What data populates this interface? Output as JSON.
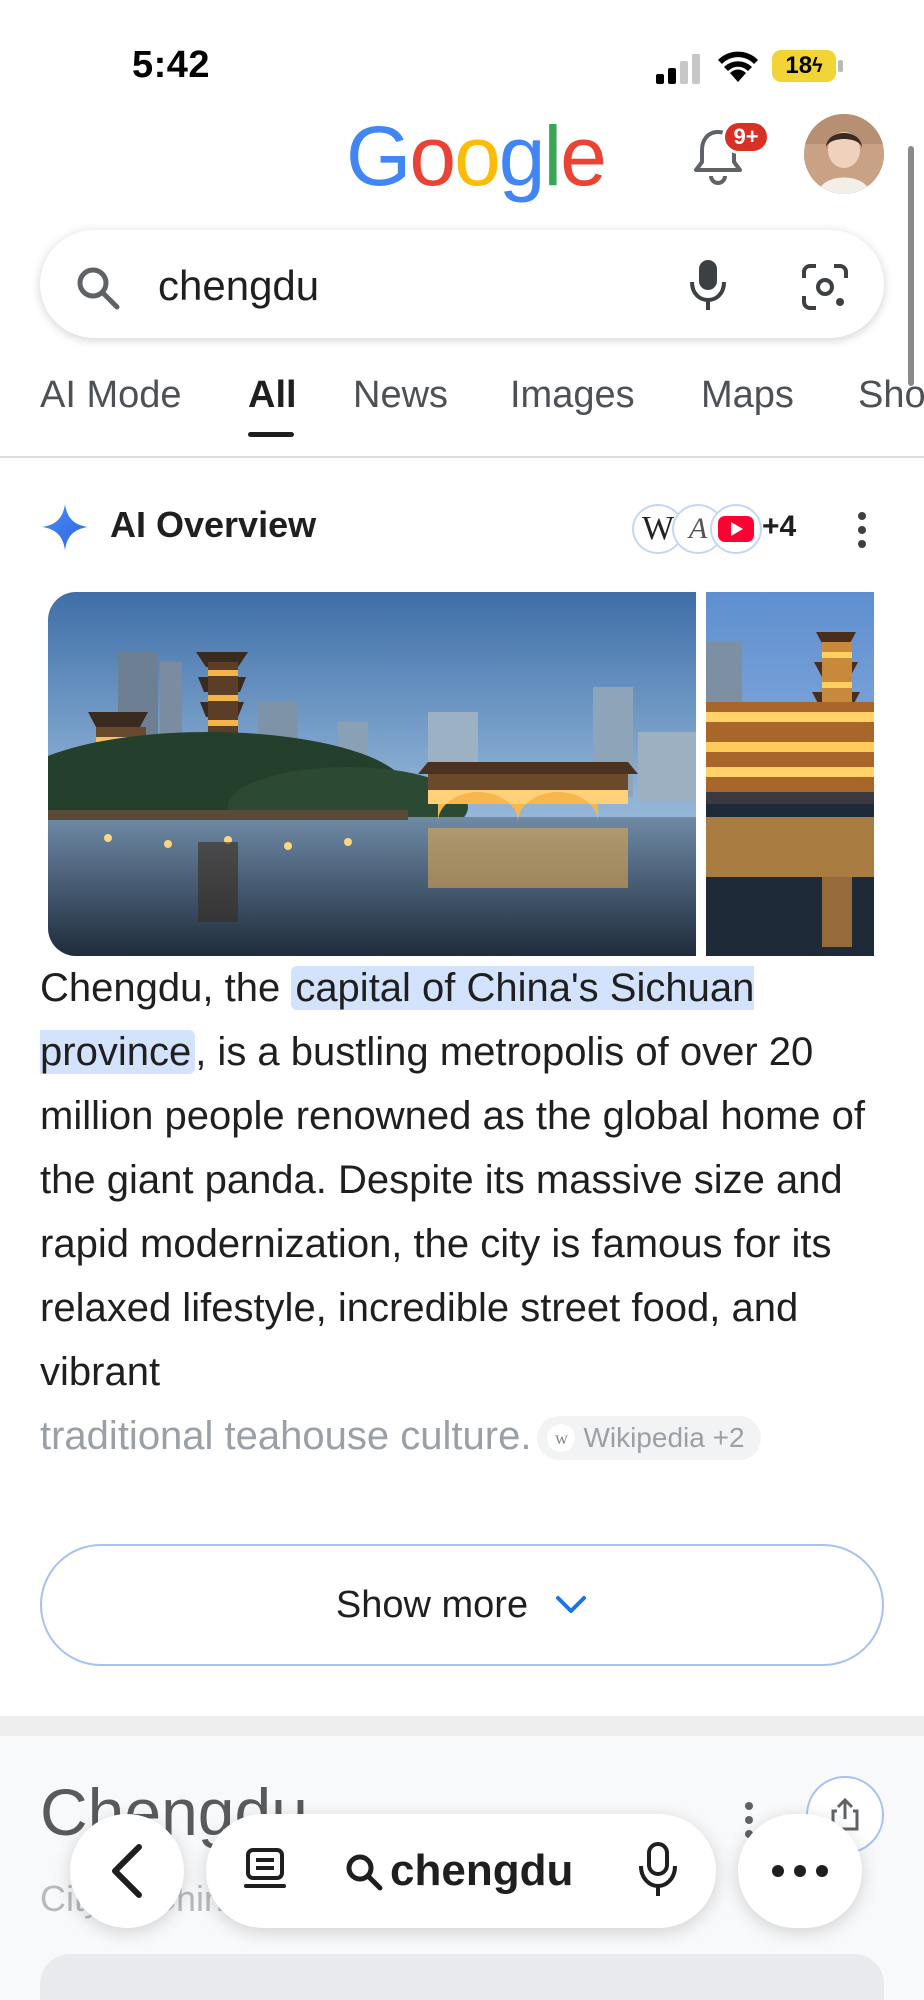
{
  "status_bar": {
    "time": "5:42",
    "battery": "18",
    "icons": [
      "signal-icon",
      "wifi-icon",
      "battery-icon"
    ]
  },
  "header": {
    "logo_letters": [
      {
        "char": "G",
        "color": "#4285F4"
      },
      {
        "char": "o",
        "color": "#EA4335"
      },
      {
        "char": "o",
        "color": "#FBBC05"
      },
      {
        "char": "g",
        "color": "#4285F4"
      },
      {
        "char": "l",
        "color": "#34A853"
      },
      {
        "char": "e",
        "color": "#EA4335"
      }
    ],
    "notification_badge": "9+"
  },
  "search": {
    "query": "chengdu",
    "icons": [
      "search-icon",
      "mic-icon",
      "lens-icon"
    ]
  },
  "tabs": [
    {
      "label": "AI Mode",
      "active": false
    },
    {
      "label": "All",
      "active": true
    },
    {
      "label": "News",
      "active": false
    },
    {
      "label": "Images",
      "active": false
    },
    {
      "label": "Maps",
      "active": false
    },
    {
      "label": "Sho",
      "active": false
    }
  ],
  "ai_overview": {
    "title": "AI Overview",
    "source_w": "W",
    "source_a": "A",
    "sources_more": "+4",
    "text_before": "Chengdu, the ",
    "text_highlight": "capital of China's Sichuan province",
    "text_after": ", is a bustling metropolis of over 20 million people renowned as the global home of the giant panda. Despite its massive size and rapid modernization, the city is famous for its relaxed lifestyle, incredible street food, and vibrant",
    "text_faded": "traditional teahouse culture.",
    "citation": "Wikipedia +2",
    "citation_icon": "w",
    "show_more": "Show more"
  },
  "knowledge_panel": {
    "title": "Chengdu",
    "subtitle": "City in China"
  },
  "bottom_bar": {
    "query": "chengdu"
  },
  "colors": {
    "accent_blue": "#1a73e8",
    "highlight": "#d3e3fd",
    "badge_red": "#d93025",
    "battery_yellow": "#f3d436"
  }
}
